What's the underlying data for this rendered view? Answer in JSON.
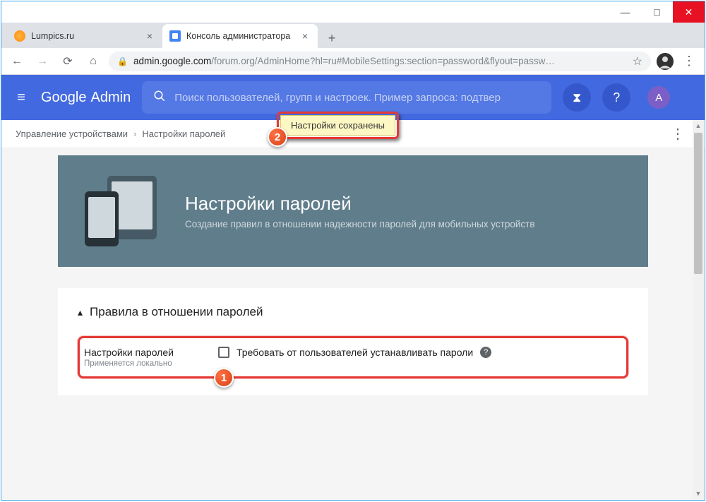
{
  "window": {
    "min": "—",
    "max": "□",
    "close": "✕"
  },
  "tabs": [
    {
      "title": "Lumpics.ru",
      "active": false
    },
    {
      "title": "Консоль администратора",
      "active": true
    }
  ],
  "newtab": "+",
  "nav": {
    "back": "←",
    "forward": "→",
    "reload": "⟳",
    "home": "⌂"
  },
  "address": {
    "lock": "🔒",
    "host": "admin.google.com",
    "path": "/forum.org/AdminHome?hl=ru#MobileSettings:section=password&flyout=passw…",
    "star": "☆"
  },
  "browser_menu": "⋮",
  "app": {
    "menu": "≡",
    "logo_g": "Google",
    "logo_a": "Admin",
    "search_placeholder": "Поиск пользователей, групп и настроек. Пример запроса: подтвер",
    "hourglass": "⧗",
    "help": "?",
    "avatar": "А"
  },
  "breadcrumb": {
    "item1": "Управление устройствами",
    "sep": "›",
    "item2": "Настройки паролей",
    "more": "⋮"
  },
  "hero": {
    "title": "Настройки паролей",
    "subtitle": "Создание правил в отношении надежности паролей для мобильных устройств"
  },
  "card": {
    "chevron": "▴",
    "title": "Правила в отношении паролей"
  },
  "setting": {
    "title": "Настройки паролей",
    "sub": "Применяется локально",
    "checkbox_label": "Требовать от пользователей устанавливать пароли",
    "help": "?"
  },
  "toast": {
    "text": "Настройки сохранены"
  },
  "badges": {
    "b1": "1",
    "b2": "2"
  }
}
